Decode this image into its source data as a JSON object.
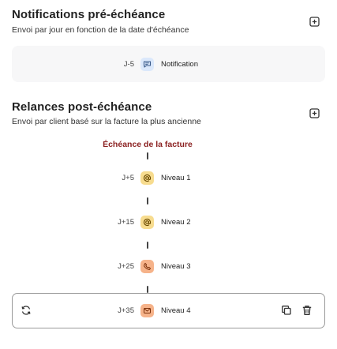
{
  "pre_due": {
    "title": "Notifications pré-échéance",
    "subtitle": "Envoi par jour en fonction de la date d'échéance",
    "rows": [
      {
        "day": "J-5",
        "label": "Notification",
        "icon": "chat-icon",
        "color": "#dbe8fb"
      }
    ]
  },
  "post_due": {
    "title": "Relances post-échéance",
    "subtitle": "Envoi par client basé sur la facture la plus ancienne",
    "deadline_label": "Échéance de la facture",
    "levels": [
      {
        "day": "J+5",
        "label": "Niveau 1",
        "icon": "at-sign-icon",
        "color": "#f7dc8f"
      },
      {
        "day": "J+15",
        "label": "Niveau 2",
        "icon": "at-sign-icon",
        "color": "#f7dc8f"
      },
      {
        "day": "J+25",
        "label": "Niveau 3",
        "icon": "phone-icon",
        "color": "#f6b38a"
      },
      {
        "day": "J+35",
        "label": "Niveau 4",
        "icon": "mail-icon",
        "color": "#f6b38a"
      }
    ]
  },
  "colors": {
    "deadline": "#8a1f1f",
    "card_bg": "#f7f7f8"
  }
}
